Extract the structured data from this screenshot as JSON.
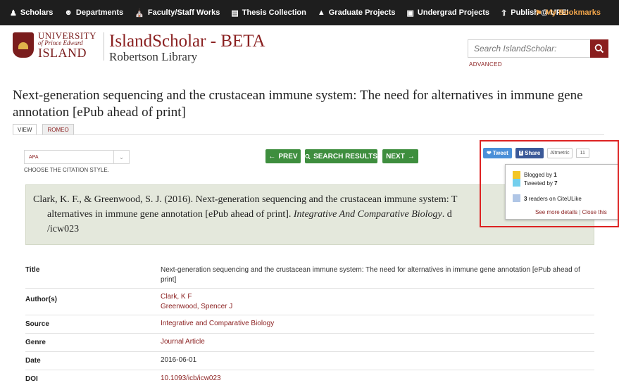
{
  "topnav": {
    "items": [
      {
        "label": "Scholars",
        "icon": "user-icon"
      },
      {
        "label": "Departments",
        "icon": "group-icon"
      },
      {
        "label": "Faculty/Staff Works",
        "icon": "institution-icon"
      },
      {
        "label": "Thesis Collection",
        "icon": "book-icon"
      },
      {
        "label": "Graduate Projects",
        "icon": "graduation-cap-icon"
      },
      {
        "label": "Undergrad Projects",
        "icon": "file-icon"
      },
      {
        "label": "Publish @ UPEI",
        "icon": "upload-icon"
      }
    ],
    "bookmarks": {
      "label": "My Bookmarks",
      "icon": "bookmark-icon"
    }
  },
  "header": {
    "logo": {
      "line1": "UNIVERSITY",
      "line2": "of Prince Edward",
      "line3": "ISLAND"
    },
    "site_title": "IslandScholar - BETA",
    "site_subtitle": "Robertson Library",
    "search_placeholder": "Search IslandScholar:",
    "advanced_label": "ADVANCED"
  },
  "page": {
    "title": "Next-generation sequencing and the crustacean immune system: The need for alternatives in immune gene annotation [ePub ahead of print]",
    "tabs": [
      "VIEW",
      "ROMEO"
    ]
  },
  "citation": {
    "style_value": "APA",
    "choose_label": "CHOOSE THE CITATION STYLE.",
    "prev_label": "PREV",
    "search_results_label": "SEARCH RESULTS",
    "next_label": "NEXT",
    "text_line1": "Clark, K. F., & Greenwood, S. J. (2016). Next-generation sequencing and the crustacean immune system: T",
    "text_line2_plain": "alternatives in immune gene annotation [ePub ahead of print]. ",
    "text_line2_italic": "Integrative And Comparative Biology",
    "text_line2_tail": ". d",
    "text_line3": "/icw023"
  },
  "share": {
    "tweet_label": "Tweet",
    "share_label": "Share",
    "altmetric_label": "Altmetric",
    "altmetric_count": "11"
  },
  "altmetric_popup": {
    "blogged_prefix": "Blogged by ",
    "blogged_count": "1",
    "tweeted_prefix": "Tweeted by ",
    "tweeted_count": "7",
    "readers_count": "3",
    "readers_suffix": " readers on CiteULike",
    "see_more": "See more details",
    "separator": " | ",
    "close": "Close this",
    "colors": {
      "blog": "#f3c626",
      "twitter": "#74cfed",
      "citeulike": "#b0c6e6"
    }
  },
  "metadata": {
    "title_label": "Title",
    "title_value": "Next-generation sequencing and the crustacean immune system: The need for alternatives in immune gene annotation [ePub ahead of print]",
    "authors_label": "Author(s)",
    "authors": [
      "Clark, K F",
      "Greenwood, Spencer J"
    ],
    "source_label": "Source",
    "source_value": "Integrative and Comparative Biology",
    "genre_label": "Genre",
    "genre_value": "Journal Article",
    "date_label": "Date",
    "date_value": "2016-06-01",
    "doi_label": "DOI",
    "doi_value": "10.1093/icb/icw023"
  },
  "colors": {
    "accent": "#8a1e1e",
    "nav_bg": "#1e1e1e",
    "bookmark": "#f2a54a",
    "green_button": "#3e8e3e",
    "highlight_border": "#dd2222"
  }
}
